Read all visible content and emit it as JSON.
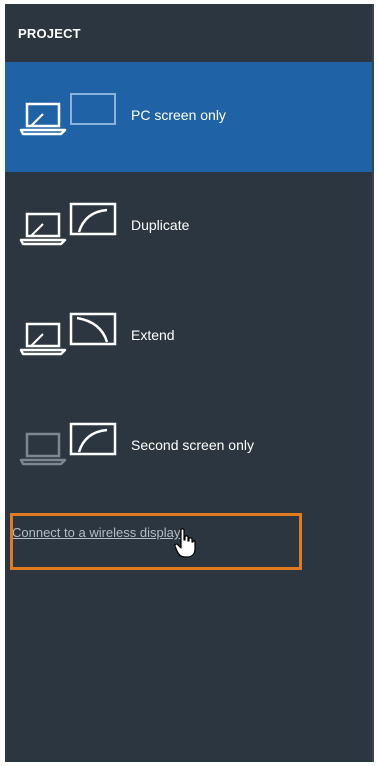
{
  "panel": {
    "title": "PROJECT",
    "options": [
      {
        "label": "PC screen only",
        "selected": true
      },
      {
        "label": "Duplicate",
        "selected": false
      },
      {
        "label": "Extend",
        "selected": false
      },
      {
        "label": "Second screen only",
        "selected": false
      }
    ],
    "wireless_link": "Connect to a wireless display"
  },
  "colors": {
    "panel_bg": "#2b3640",
    "selected_bg": "#1f63a6",
    "highlight_border": "#e07b1f",
    "link_text": "#b4bcc4"
  },
  "icons": {
    "laptop": "laptop-icon",
    "monitor": "monitor-icon",
    "cursor": "hand-cursor-icon"
  }
}
